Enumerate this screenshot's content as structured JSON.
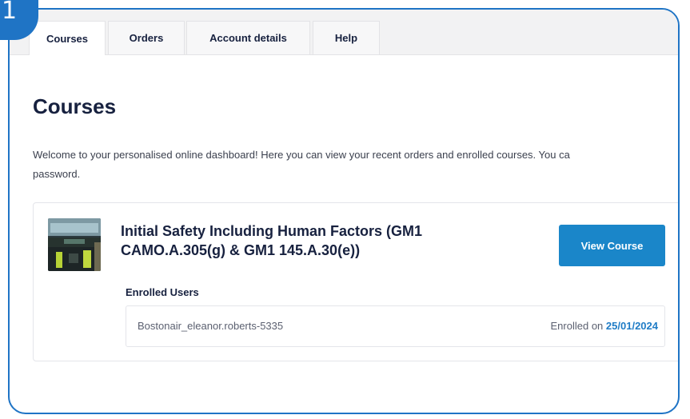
{
  "step_badge": "1",
  "tabs": [
    {
      "label": "Courses",
      "active": true
    },
    {
      "label": "Orders",
      "active": false
    },
    {
      "label": "Account details",
      "active": false
    },
    {
      "label": "Help",
      "active": false
    }
  ],
  "page": {
    "title": "Courses",
    "welcome_line1": "Welcome to your personalised online dashboard! Here you can view your recent orders and enrolled courses. You ca",
    "welcome_line2": "password."
  },
  "course": {
    "title_line1": "Initial Safety Including Human Factors (GM1",
    "title_line2": "CAMO.A.305(g) & GM1 145.A.30(e))",
    "view_button": "View Course",
    "enrolled_label": "Enrolled Users",
    "user": "Bostonair_eleanor.roberts-5335",
    "enrolled_prefix": "Enrolled on",
    "enrolled_date": "25/01/2024",
    "thumbnail_icon": "cockpit-photo"
  },
  "colors": {
    "accent": "#1f74c5",
    "button": "#1a86c9",
    "heading": "#17213f"
  }
}
